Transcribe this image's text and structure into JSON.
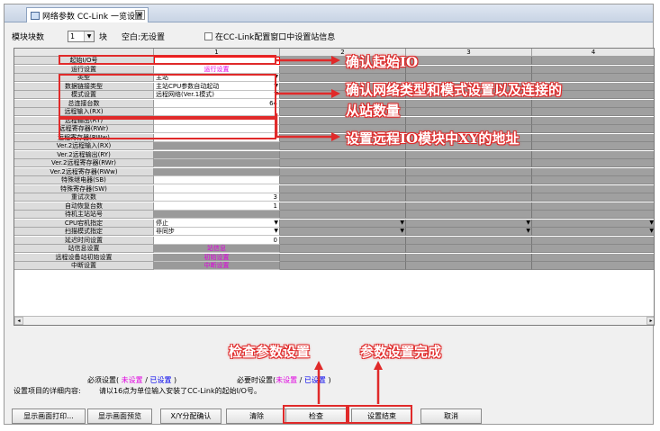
{
  "tab": {
    "title": "网络参数 CC-Link 一览设置",
    "close_label": "×"
  },
  "toolbar": {
    "module_count_label": "模块块数",
    "module_count_value": "1",
    "unit_label": "块",
    "blank_label": "空白:无设置",
    "checkbox_label": "在CC-Link配置窗口中设置站信息"
  },
  "grid": {
    "columns": [
      "1",
      "2",
      "3",
      "4"
    ],
    "rows": [
      {
        "label": "起始I/O号",
        "value": ""
      },
      {
        "label": "运行设置",
        "value": "运行设置"
      },
      {
        "label": "类型",
        "value": "主站"
      },
      {
        "label": "数据链接类型",
        "value": "主站CPU参数自动起动"
      },
      {
        "label": "模式设置",
        "value": "远程网络(Ver.1模式)"
      },
      {
        "label": "总连接台数",
        "value": "64"
      },
      {
        "label": "远程输入(RX)",
        "value": ""
      },
      {
        "label": "远程输出(RY)",
        "value": ""
      },
      {
        "label": "远程寄存器(RWr)",
        "value": ""
      },
      {
        "label": "远程寄存器(RWw)",
        "value": ""
      },
      {
        "label": "Ver.2远程输入(RX)",
        "value": ""
      },
      {
        "label": "Ver.2远程输出(RY)",
        "value": ""
      },
      {
        "label": "Ver.2远程寄存器(RWr)",
        "value": ""
      },
      {
        "label": "Ver.2远程寄存器(RWw)",
        "value": ""
      },
      {
        "label": "特殊继电器(SB)",
        "value": ""
      },
      {
        "label": "特殊寄存器(SW)",
        "value": ""
      },
      {
        "label": "重试次数",
        "value": "3"
      },
      {
        "label": "自动恢复台数",
        "value": "1"
      },
      {
        "label": "待机主站站号",
        "value": ""
      },
      {
        "label": "CPU宕机指定",
        "value": "停止"
      },
      {
        "label": "扫描模式指定",
        "value": "非同步"
      },
      {
        "label": "延迟时间设置",
        "value": "0"
      },
      {
        "label": "站信息设置",
        "value": "站信息"
      },
      {
        "label": "远程设备站初始设置",
        "value": "初始设置"
      },
      {
        "label": "中断设置",
        "value": "中断设置"
      }
    ]
  },
  "annotations": {
    "start_io": "确认起始IO",
    "network_type_line1": "确认网络类型和模式设置以及连接的",
    "network_type_line2": "从站数量",
    "remote_xy": "设置远程IO模块中XY的地址",
    "check_params": "检查参数设置",
    "params_done": "参数设置完成"
  },
  "legend": {
    "required_prefix": "必须设置(",
    "not_set": "未设置",
    "slash": "/",
    "set": "已设置",
    "suffix": ")",
    "optional_prefix": "必要时设置(",
    "detail_label": "设置项目的详细内容:",
    "detail_text": "请以16点为单位输入安装了CC-Link的起始I/O号。"
  },
  "buttons": {
    "print": "显示画面打印...",
    "preview": "显示画面预览",
    "xy_confirm": "X/Y分配确认",
    "clear": "清除",
    "check": "检查",
    "finish": "设置结束",
    "cancel": "取消"
  },
  "colors": {
    "annotation": "#e02a2a",
    "not_set": "#e000e0",
    "set": "#0000ee"
  }
}
